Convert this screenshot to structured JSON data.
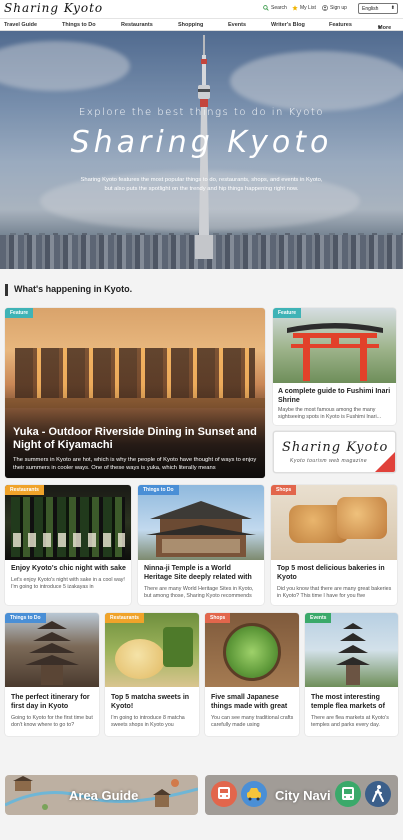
{
  "header": {
    "logo": "Sharing Kyoto",
    "search": "Search",
    "mylist": "My List",
    "signup": "Sign up",
    "language": "English"
  },
  "nav": [
    "Travel Guide",
    "Things to Do",
    "Restaurants",
    "Shopping",
    "Events",
    "Writer's Blog",
    "Features",
    "More"
  ],
  "hero": {
    "tagline": "Explore the best things to do in Kyoto",
    "title": "Sharing Kyoto",
    "description_line1": "Sharing Kyoto features the most popular things to do, restaurants, shops, and events in Kyoto,",
    "description_line2": "but also puts the spotlight on the trendy and hip things happening right now."
  },
  "section_title": "What's happening in Kyoto.",
  "big_card": {
    "tag": "Feature",
    "title": "Yuka - Outdoor Riverside Dining in Sunset and Night of Kiyamachi",
    "desc": "The summers in Kyoto are hot, which is why the people of Kyoto have thought of ways to enjoy their summers in cooler ways. One of these ways is yuka, which literally means"
  },
  "side_card": {
    "tag": "Feature",
    "title": "A complete guide to Fushimi Inari Shrine",
    "desc": "Maybe the most famous among the many sightseeing spots in Kyoto is Fushimi Inari...",
    "banner_title": "Sharing Kyoto",
    "banner_sub": "Kyoto tourism web magazine"
  },
  "row1": [
    {
      "tag": "Restaurants",
      "title": "Enjoy Kyoto's chic night with sake",
      "desc": "Let's enjoy Kyoto's night with sake in a cool way! I'm going to introduce 5 izakayas in"
    },
    {
      "tag": "Things to Do",
      "title": "Ninna-ji Temple is a World Heritage Site deeply related with",
      "desc": "There are many World Heritage Sites in Kyoto, but among those, Sharing Kyoto recommends"
    },
    {
      "tag": "Shops",
      "title": "Top 5 most delicious bakeries in Kyoto",
      "desc": "Did you know that there are many great bakeries in Kyoto? This time I have for you five"
    }
  ],
  "row2": [
    {
      "tag": "Things to Do",
      "title": "The perfect itinerary for first day in Kyoto",
      "desc": "Going to Kyoto for the first time but don't know where to go to?"
    },
    {
      "tag": "Restaurants",
      "title": "Top 5 matcha sweets in Kyoto!",
      "desc": "I'm going to introduce 8 matcha sweets shops in Kyoto you"
    },
    {
      "tag": "Shops",
      "title": "Five small Japanese things made with great",
      "desc": "You can see many traditional crafts carefully made using"
    },
    {
      "tag": "Events",
      "title": "The most interesting temple flea markets of",
      "desc": "There are flea markets at Kyoto's temples and parks every day."
    }
  ],
  "bottom": {
    "area_guide": "Area Guide",
    "city_navi": "City Navi"
  },
  "colors": {
    "feature": "#3fb3b6",
    "restaurants": "#f0a32a",
    "things_to_do": "#4a8fd6",
    "shops": "#e2664c",
    "events": "#3aa96a"
  }
}
